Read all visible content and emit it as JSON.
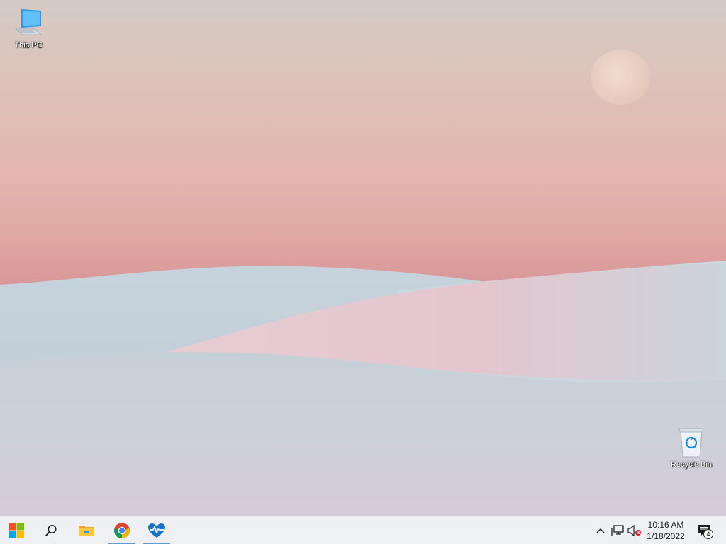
{
  "desktop": {
    "icons": [
      {
        "label": "This PC",
        "icon": "computer-icon"
      },
      {
        "label": "Recycle Bin",
        "icon": "recycle-bin-icon"
      }
    ]
  },
  "taskbar": {
    "pinned": [
      {
        "name": "Start",
        "icon": "windows-logo-icon",
        "active": false
      },
      {
        "name": "Search",
        "icon": "search-icon",
        "active": false
      },
      {
        "name": "File Explorer",
        "icon": "folder-icon",
        "active": false
      },
      {
        "name": "Google Chrome",
        "icon": "chrome-icon",
        "active": true
      },
      {
        "name": "Health",
        "icon": "heart-pulse-icon",
        "active": true
      }
    ],
    "tray": {
      "chevron_icon": "chevron-up-icon",
      "network_icon": "network-icon",
      "volume_icon": "volume-muted-icon"
    },
    "clock": {
      "time": "10:16 AM",
      "date": "1/18/2022"
    },
    "notifications": {
      "count": "4",
      "icon": "notification-center-icon"
    }
  },
  "colors": {
    "taskbar_bg": "#eef0f3",
    "active_indicator": "#5f9bd6",
    "sky_top": "#d3ccc5",
    "sky_bottom": "#d9999a",
    "dune": "#c9d2da"
  }
}
